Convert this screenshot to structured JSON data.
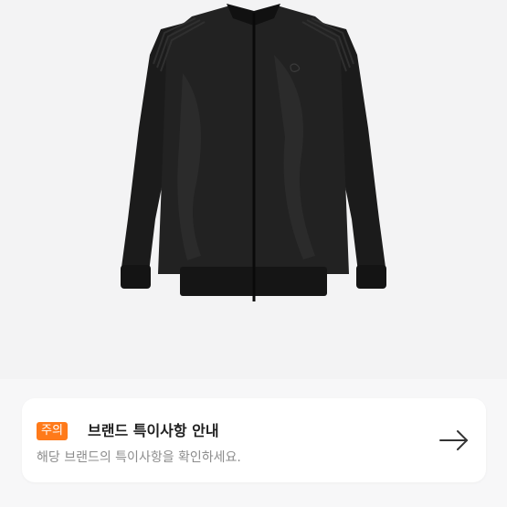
{
  "notice": {
    "badge": "주의",
    "title": "브랜드 특이사항 안내",
    "description": "해당 브랜드의 특이사항을 확인하세요.",
    "arrow_icon": "arrow-right-icon"
  },
  "colors": {
    "badge_bg": "#ff7a1a",
    "jacket": "#1a1a1a",
    "background": "#f3f3f4"
  }
}
